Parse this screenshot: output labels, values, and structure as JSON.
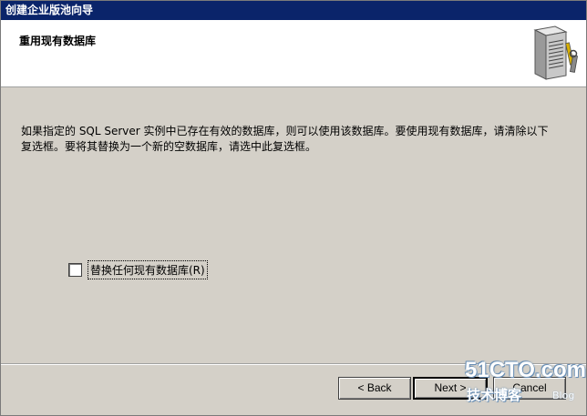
{
  "window": {
    "title": "创建企业版池向导"
  },
  "header": {
    "title": "重用现有数据库",
    "icon": "server-with-tools-icon"
  },
  "main": {
    "description": "如果指定的 SQL Server 实例中已存在有效的数据库，则可以使用该数据库。要使用现有数据库，请清除以下复选框。要将其替换为一个新的空数据库，请选中此复选框。",
    "checkbox": {
      "label": "替换任何现有数据库(R)",
      "checked": false
    }
  },
  "footer": {
    "back_label": "< Back",
    "next_label": "Next >",
    "cancel_label": "Cancel"
  },
  "watermark": {
    "site": "51CTO.com",
    "subtitle": "技术博客",
    "blog": "Blog"
  }
}
